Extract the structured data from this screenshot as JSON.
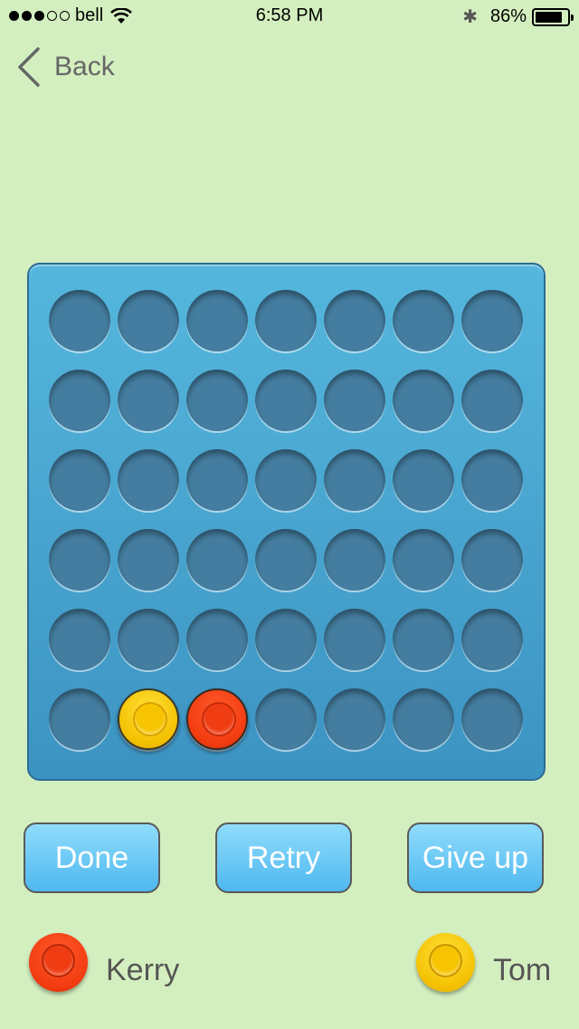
{
  "status_bar": {
    "signal_filled": 3,
    "signal_total": 5,
    "carrier": "bell",
    "time": "6:58 PM",
    "battery_percent": "86%",
    "battery_level": 0.86
  },
  "nav": {
    "back_label": "Back"
  },
  "board": {
    "rows": 6,
    "columns": 7,
    "cells": [
      [
        "empty",
        "empty",
        "empty",
        "empty",
        "empty",
        "empty",
        "empty"
      ],
      [
        "empty",
        "empty",
        "empty",
        "empty",
        "empty",
        "empty",
        "empty"
      ],
      [
        "empty",
        "empty",
        "empty",
        "empty",
        "empty",
        "empty",
        "empty"
      ],
      [
        "empty",
        "empty",
        "empty",
        "empty",
        "empty",
        "empty",
        "empty"
      ],
      [
        "empty",
        "empty",
        "empty",
        "empty",
        "empty",
        "empty",
        "empty"
      ],
      [
        "empty",
        "yellow",
        "red",
        "empty",
        "empty",
        "empty",
        "empty"
      ]
    ]
  },
  "buttons": {
    "done": "Done",
    "retry": "Retry",
    "give_up": "Give up"
  },
  "players": [
    {
      "name": "Kerry",
      "color": "red"
    },
    {
      "name": "Tom",
      "color": "yellow"
    }
  ],
  "colors": {
    "background": "#d4efbf",
    "board": "#4aa6d2",
    "red_piece": "#f23b10",
    "yellow_piece": "#f4c000"
  }
}
